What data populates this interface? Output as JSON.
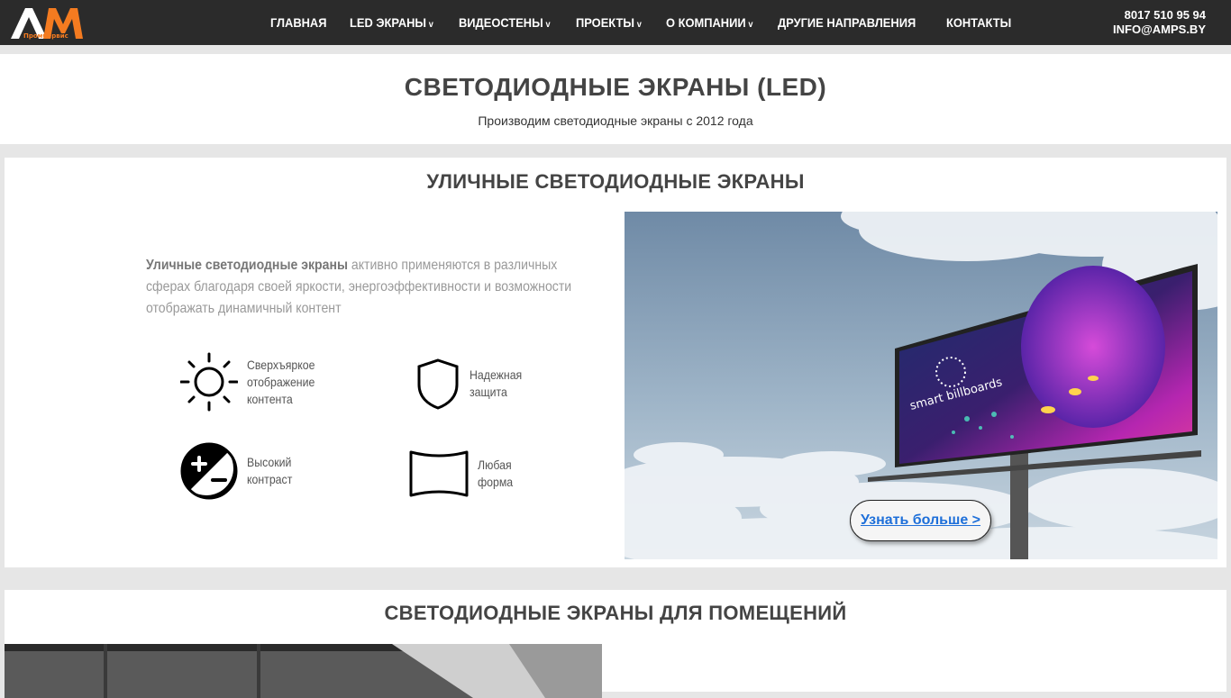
{
  "header": {
    "logo_text": "AM",
    "logo_sub": "ПромСервис",
    "nav": [
      {
        "label": "ГЛАВНАЯ",
        "dropdown": false
      },
      {
        "label": "LED ЭКРАНЫ",
        "dropdown": true
      },
      {
        "label": "ВИДЕОСТЕНЫ",
        "dropdown": true
      },
      {
        "label": "ПРОЕКТЫ",
        "dropdown": true
      },
      {
        "label": "О КОМПАНИИ",
        "dropdown": true
      },
      {
        "label": "ДРУГИЕ НАПРАВЛЕНИЯ",
        "dropdown": false
      },
      {
        "label": "КОНТАКТЫ",
        "dropdown": false
      }
    ],
    "phone": "8017 510 95 94",
    "email": "INFO@AMPS.BY"
  },
  "hero": {
    "title": "СВЕТОДИОДНЫЕ ЭКРАНЫ (LED)",
    "subtitle": "Производим светодиодные экраны с 2012 года"
  },
  "outdoor": {
    "title": "УЛИЧНЫЕ СВЕТОДИОДНЫЕ ЭКРАНЫ",
    "lead_bold": "Уличные светодиодные экраны",
    "lead_rest": " активно применяются в различных сферах благодаря своей яркости, энергоэффективности и возможности отображать динамичный контент",
    "features": [
      {
        "icon": "sun-icon",
        "label": "Сверхъяркое отображение контента"
      },
      {
        "icon": "shield-icon",
        "label": "Надежная защита"
      },
      {
        "icon": "contrast-icon",
        "label": "Высокий контраст"
      },
      {
        "icon": "curved-screen-icon",
        "label": "Любая форма"
      }
    ],
    "billboard_text": "smart billboards",
    "more_button": "Узнать больше >"
  },
  "indoor": {
    "title": "СВЕТОДИОДНЫЕ ЭКРАНЫ ДЛЯ ПОМЕЩЕНИЙ"
  },
  "colors": {
    "header_bg": "#2b2b2b",
    "logo_orange": "#f47b20",
    "link_blue": "#1e6fd9"
  }
}
